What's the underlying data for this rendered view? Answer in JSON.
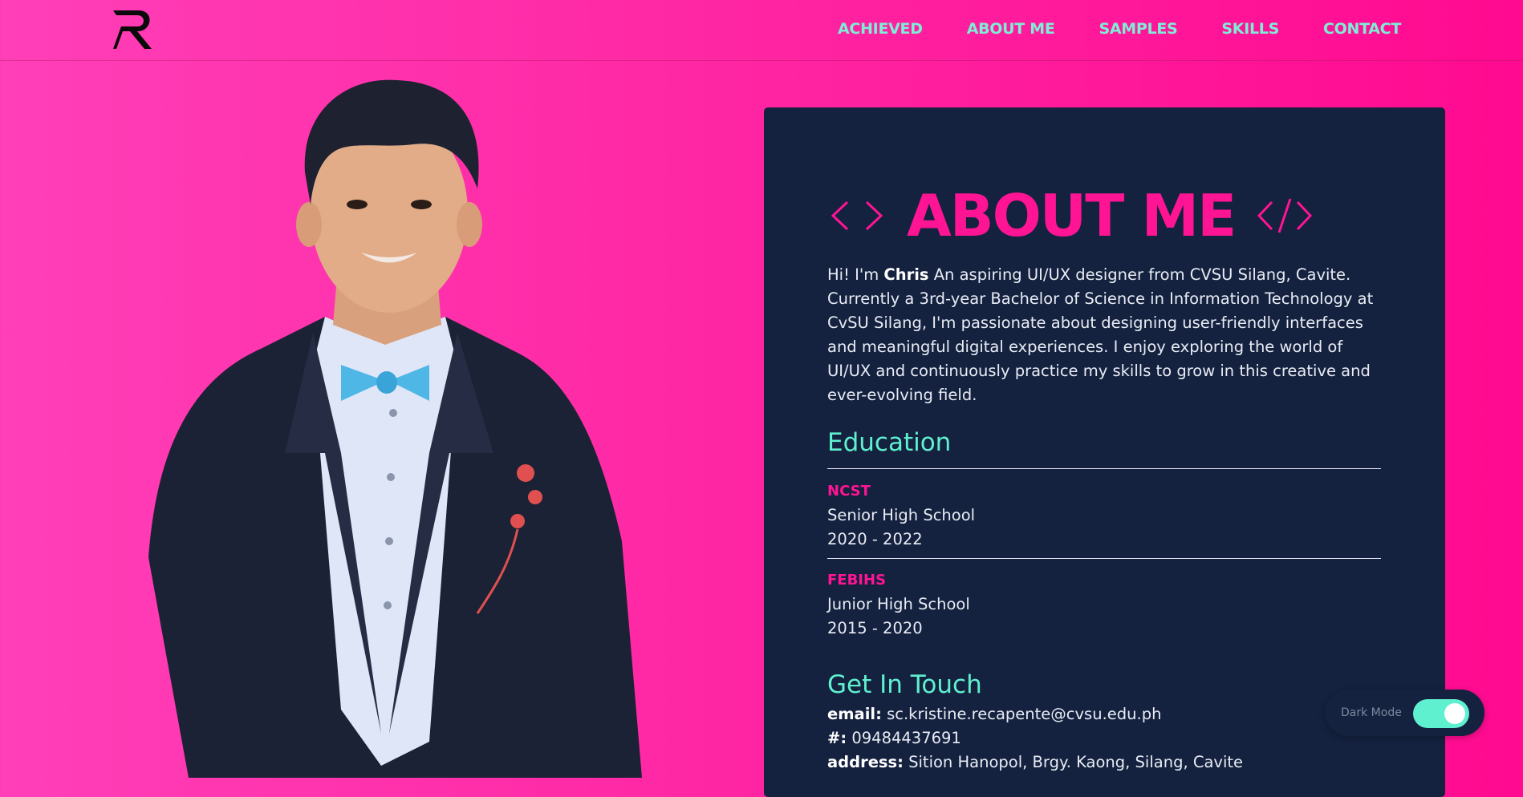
{
  "nav": {
    "items": [
      {
        "label": "ACHIEVED"
      },
      {
        "label": "ABOUT ME"
      },
      {
        "label": "SAMPLES"
      },
      {
        "label": "SKILLS"
      },
      {
        "label": "CONTACT"
      }
    ]
  },
  "about": {
    "title": "ABOUT ME",
    "intro_prefix": "Hi! I'm ",
    "name": "Chris",
    "intro_rest": " An aspiring UI/UX designer from CVSU Silang, Cavite. Currently a 3rd-year Bachelor of Science in Information Technology at CvSU Silang, I'm passionate about designing user-friendly interfaces and meaningful digital experiences. I enjoy exploring the world of UI/UX and continuously practice my skills to grow in this creative and ever-evolving field."
  },
  "education": {
    "title": "Education",
    "items": [
      {
        "school": "NCST",
        "level": "Senior High School",
        "years": "2020 - 2022"
      },
      {
        "school": "FEBIHS",
        "level": "Junior High School",
        "years": "2015 - 2020"
      }
    ]
  },
  "contact": {
    "title": "Get In Touch",
    "email_label": "email:",
    "email": "sc.kristine.recapente@cvsu.edu.ph",
    "phone_label": "#:",
    "phone": "09484437691",
    "address_label": "address:",
    "address": "Sition Hanopol, Brgy. Kaong, Silang, Cavite"
  },
  "toggle": {
    "label": "Dark Mode",
    "on": true
  },
  "colors": {
    "accent": "#ff1493",
    "teal": "#5ff0cf",
    "card": "#14213f",
    "nav": "#7eeed6"
  },
  "icons": {
    "logo": "r-logo",
    "code_left": "angle-brackets-icon",
    "code_right": "closing-tag-icon"
  }
}
